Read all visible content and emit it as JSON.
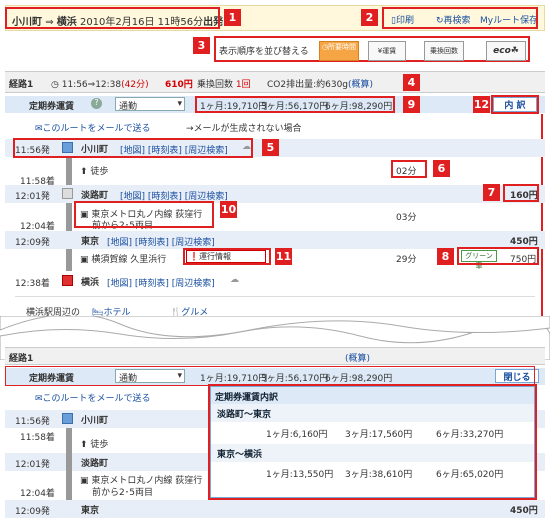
{
  "header": {
    "from": "小川町",
    "arrow": "⇒",
    "to": "横浜",
    "datetime": "2010年2月16日 11時56分",
    "dep_suffix": "出発",
    "print": "印刷",
    "research": "再検索",
    "save": "Myルート保存"
  },
  "sort": {
    "label": "表示順序を並び替える",
    "btn_time": "所要時間",
    "btn_fare": "運賃",
    "btn_transfer": "乗換回数",
    "btn_eco": "eco"
  },
  "route": {
    "name": "経路1",
    "time": "11:56⇒12:38",
    "duration": "(42分)",
    "fare": "610円",
    "transfer_label": "乗換回数",
    "transfer_count": "1回",
    "co2": "CO2排出量:約630g",
    "co2_link": "(概算)"
  },
  "pass": {
    "label": "定期券運賃",
    "help": "?",
    "select": "通勤",
    "m1": "1ヶ月:19,710円",
    "m3": "3ヶ月:56,170円",
    "m6": "6ヶ月:98,290円",
    "detail_btn": "内 訳",
    "close_btn": "閉じる"
  },
  "mail": {
    "send": "このルートをメールで送る",
    "note": "→メールが生成されない場合"
  },
  "stations": [
    {
      "time": "11:56発",
      "name": "小川町",
      "links": "[地図] [時刻表] [周辺検索]"
    },
    {
      "time": "12:01発",
      "name": "淡路町",
      "links": "[地図] [時刻表] [周辺検索]",
      "arr": "11:58着"
    },
    {
      "time": "12:09発",
      "name": "東京",
      "links": "[地図] [時刻表] [周辺検索]",
      "arr": "12:04着"
    },
    {
      "time": "12:38着",
      "name": "横浜",
      "links": "[地図] [時刻表] [周辺検索]"
    }
  ],
  "legs": [
    {
      "mode": "徒歩",
      "min": "02分"
    },
    {
      "line": "東京メトロ丸ノ内線 荻窪行",
      "sub": "前から2･5両目",
      "min": "03分",
      "fare": "160円"
    },
    {
      "line": "横須賀線 久里浜行",
      "status": "運行情報",
      "min": "29分",
      "green": "グリーン車",
      "green_fare": "750円",
      "fare": "450円"
    }
  ],
  "nearby": {
    "label": "横浜駅周辺の",
    "hotel": "ホテル",
    "gourmet": "グルメ"
  },
  "popup": {
    "title": "定期券運賃内訳",
    "sec1": "淡路町〜東京",
    "s1m1": "1ヶ月:6,160円",
    "s1m3": "3ヶ月:17,560円",
    "s1m6": "6ヶ月:33,270円",
    "sec2": "東京〜横浜",
    "s2m1": "1ヶ月:13,550円",
    "s2m3": "3ヶ月:38,610円",
    "s2m6": "6ヶ月:65,020円"
  },
  "markers": [
    "1",
    "2",
    "3",
    "4",
    "5",
    "6",
    "7",
    "8",
    "9",
    "10",
    "11",
    "12"
  ]
}
